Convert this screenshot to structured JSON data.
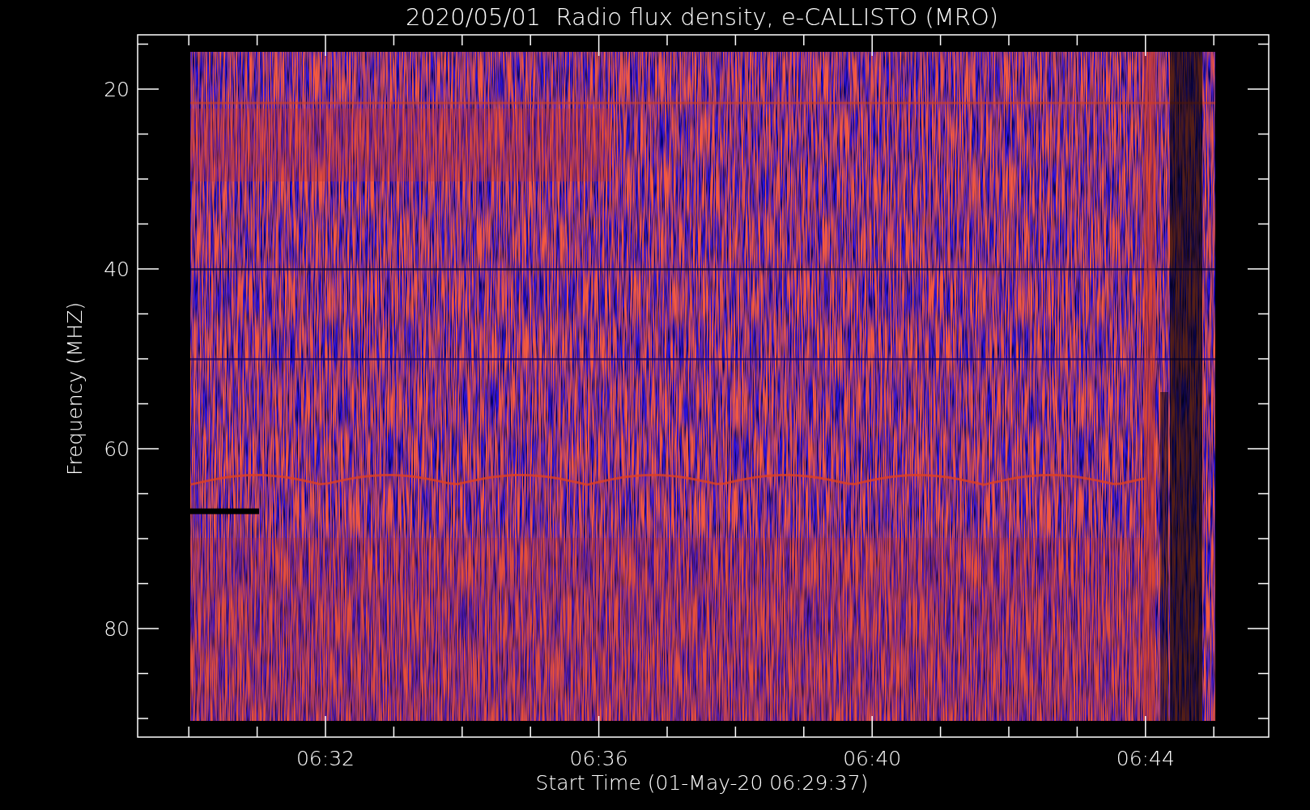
{
  "title": "2020/05/01  Radio flux density, e-CALLISTO (MRO)",
  "y_axis": {
    "label": "Frequency (MHZ)",
    "ticks": [
      "20",
      "40",
      "60",
      "80"
    ]
  },
  "x_axis": {
    "label": "Start Time (01-May-20 06:29:37)",
    "ticks": [
      "06:32",
      "06:36",
      "06:40",
      "06:44"
    ]
  }
}
